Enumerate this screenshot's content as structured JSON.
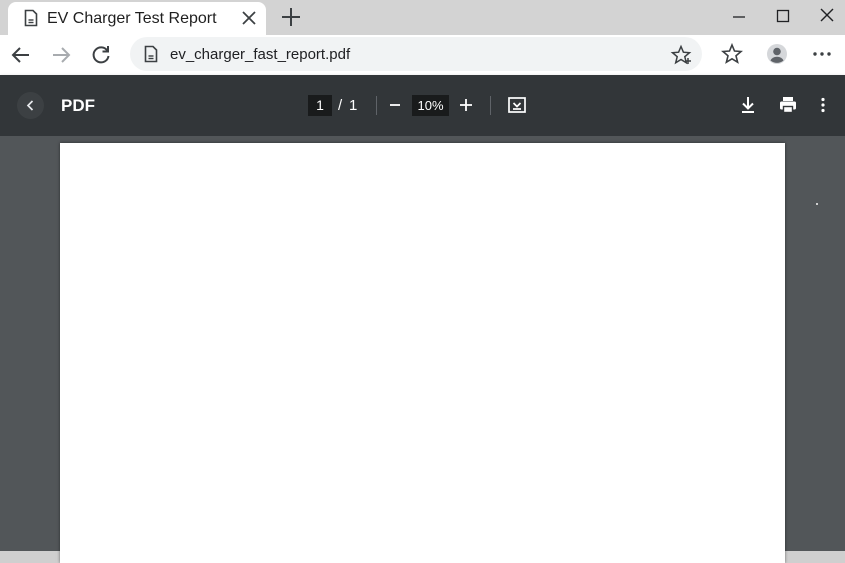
{
  "tab": {
    "title": "EV Charger Test Report",
    "favicon": "document-icon"
  },
  "window_controls": [
    "minimize-icon",
    "maximize-icon",
    "close-icon"
  ],
  "address_bar": {
    "url": "ev_charger_fast_report.pdf"
  },
  "pdf_viewer": {
    "title": "PDF",
    "current_page": "1",
    "page_separator": "/",
    "total_pages": "1",
    "zoom": "10%"
  },
  "colors": {
    "tabstrip": "#d3d3d3",
    "pdf_toolbar": "#323639",
    "viewer_background": "#525659",
    "page": "#ffffff"
  }
}
